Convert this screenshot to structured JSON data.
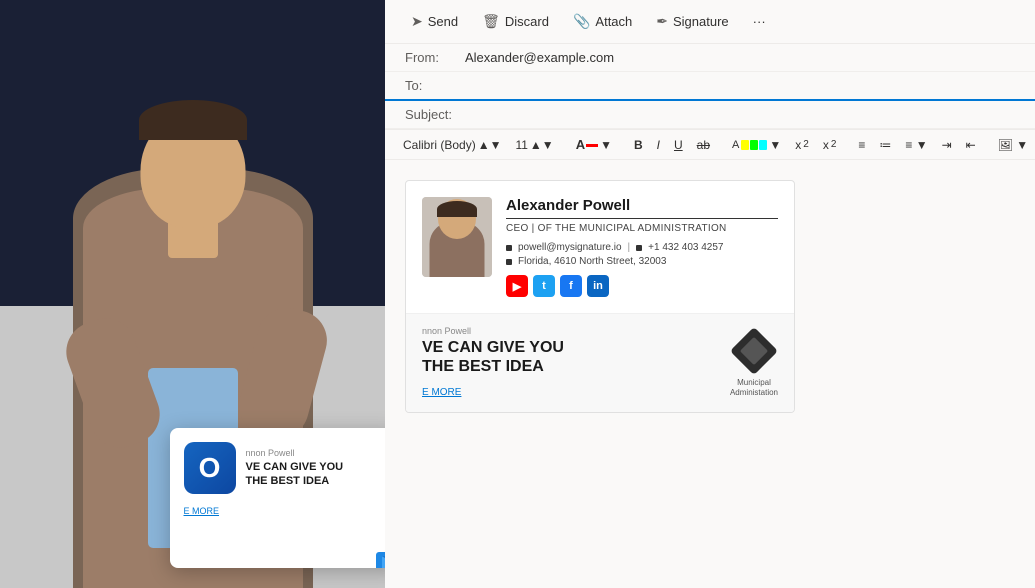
{
  "toolbar": {
    "send_label": "Send",
    "discard_label": "Discard",
    "attach_label": "Attach",
    "signature_label": "Signature",
    "more_label": "···"
  },
  "email": {
    "from_label": "From:",
    "to_label": "To:",
    "subject_label": "Subject:",
    "from_value": "Alexander@example.com",
    "to_value": "",
    "subject_value": ""
  },
  "format": {
    "font_family": "Calibri (Body)",
    "font_size": "11",
    "bold": "B",
    "italic": "I",
    "underline": "U",
    "strikethrough": "ab"
  },
  "signature": {
    "name": "Alexander Powell",
    "title": "CEO | OF THE MUNICIPAL ADMINISTRATION",
    "email": "powell@mysignature.io",
    "phone": "+1 432 403 4257",
    "address": "Florida, 4610 North Street, 32003",
    "social": {
      "youtube": "▶",
      "twitter": "t",
      "facebook": "f",
      "linkedin": "in"
    },
    "banner": {
      "from_label": "nnon Powell",
      "headline_line1": "VE CAN GIVE YOU",
      "headline_line2": "THE BEST IDEA",
      "link_label": "E MORE",
      "logo_line1": "Municipal",
      "logo_line2": "Administation"
    }
  },
  "outlook_card": {
    "from_label": "nnon Powell",
    "title_line1": "VE CAN GIVE YOU",
    "title_line2": "THE BEST IDEA",
    "link_label": "E MORE"
  }
}
